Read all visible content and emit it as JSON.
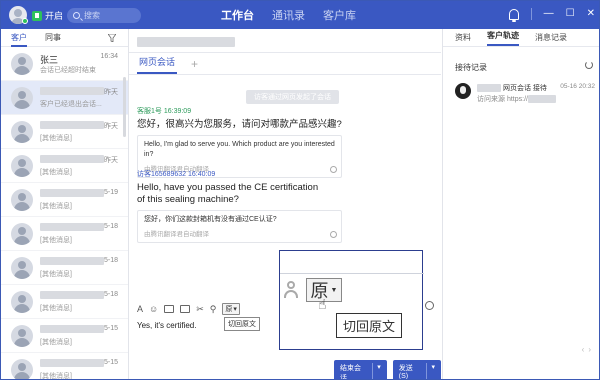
{
  "topbar": {
    "status": "开启",
    "search_placeholder": "搜索",
    "nav": [
      "工作台",
      "通讯录",
      "客户库"
    ]
  },
  "left": {
    "tabs": [
      "客户",
      "同事"
    ],
    "contacts": [
      {
        "name": "张三",
        "preview": "会话已经超时结束",
        "time": "16:34"
      },
      {
        "name": "",
        "preview": "客户已经退出会话...",
        "time": "昨天"
      },
      {
        "name": "",
        "preview": "[其他消息]",
        "time": "昨天"
      },
      {
        "name": "",
        "preview": "[其他消息]",
        "time": "昨天"
      },
      {
        "name": "",
        "preview": "[其他消息]",
        "time": "5-19"
      },
      {
        "name": "",
        "preview": "[其他消息]",
        "time": "5-18"
      },
      {
        "name": "",
        "preview": "[其他消息]",
        "time": "5-18"
      },
      {
        "name": "",
        "preview": "[其他消息]",
        "time": "5-18"
      },
      {
        "name": "",
        "preview": "[其他消息]",
        "time": "5-15"
      },
      {
        "name": "",
        "preview": "[其他消息]",
        "time": "5-15"
      }
    ]
  },
  "chat": {
    "tab": "网页会话",
    "plus": "+",
    "system_msg": "访客通过网页发起了会话",
    "messages": [
      {
        "meta": "客服1号 16:39:09",
        "text": "您好，很高兴为您服务，请问对哪款产品感兴趣?",
        "translation": "Hello, I'm glad to serve you. Which product are you interested in?",
        "source": "由腾讯翻译君自动翻译"
      },
      {
        "meta": "访客165689632 16:40:09",
        "text": "Hello,  have you passed the CE certification of this sealing machine?",
        "translation": "您好，你们这款封箱机有没有通过CE认证?",
        "source": "由腾讯翻译君自动翻译"
      }
    ],
    "toolbar": {
      "yuan": "原",
      "tooltip": "切回原文"
    },
    "reply": "Yes, it's certified.",
    "btn_end": "结束会话",
    "btn_send": "发送(S)"
  },
  "zoom": {
    "yuan": "原",
    "label": "切回原文"
  },
  "right": {
    "tabs": [
      "资料",
      "客户轨迹",
      "消息记录"
    ],
    "title": "接待记录",
    "record": {
      "line1": "网页会话 接待",
      "line2": "访问来源 https://",
      "time": "05-16 20:32"
    }
  }
}
